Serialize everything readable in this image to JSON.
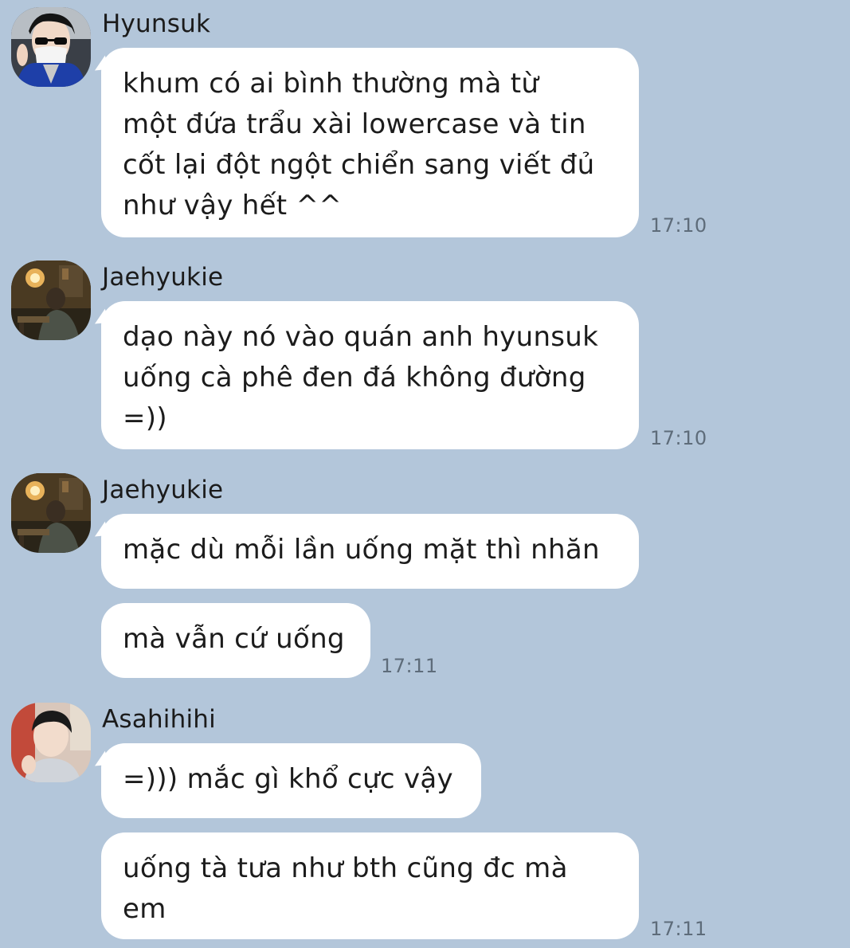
{
  "messages": [
    {
      "sender": "Hyunsuk",
      "avatar": "avatar-hyunsuk",
      "bubbles": [
        {
          "text": "khum có ai bình thường mà từ\nmột đứa trẩu xài lowercase và tin\ncốt lại đột ngột chiển sang viết đủ\nnhư vậy hết ^^"
        }
      ],
      "time": "17:10"
    },
    {
      "sender": "Jaehyukie",
      "avatar": "avatar-jaehyukie",
      "bubbles": [
        {
          "text": "dạo này nó vào quán anh hyunsuk\nuống cà phê đen đá không đường\n=))"
        }
      ],
      "time": "17:10"
    },
    {
      "sender": "Jaehyukie",
      "avatar": "avatar-jaehyukie",
      "bubbles": [
        {
          "text": "mặc dù mỗi lần uống mặt thì nhăn"
        },
        {
          "text": "mà vẫn cứ uống"
        }
      ],
      "time": "17:11"
    },
    {
      "sender": "Asahihihi",
      "avatar": "avatar-asahi",
      "bubbles": [
        {
          "text": "=))) mắc gì khổ cực vậy"
        },
        {
          "text": "uống tà tưa như bth cũng đc mà\nem"
        }
      ],
      "time": "17:11"
    }
  ],
  "colors": {
    "background": "#b3c6da",
    "bubble": "#ffffff",
    "text": "#1c1c1c",
    "timestamp": "#5e6c7a"
  }
}
